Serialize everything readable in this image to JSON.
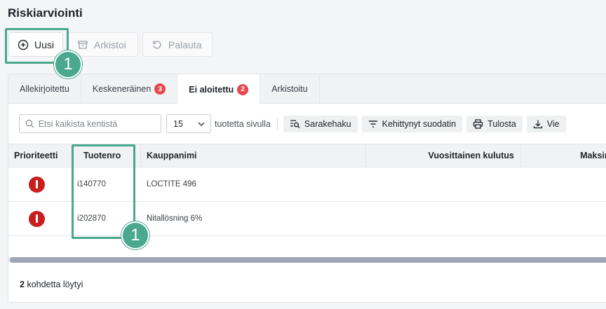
{
  "page": {
    "title": "Riskiarviointi"
  },
  "actions": {
    "new_label": "Uusi",
    "archive_label": "Arkistoi",
    "restore_label": "Palauta"
  },
  "tabs": [
    {
      "label": "Allekirjoitettu",
      "badge": null
    },
    {
      "label": "Keskeneräinen",
      "badge": "3"
    },
    {
      "label": "Ei aloitettu",
      "badge": "2",
      "active": true
    },
    {
      "label": "Arkistoitu",
      "badge": null
    }
  ],
  "toolbar": {
    "search_placeholder": "Etsi kaikista kentistä",
    "page_size": "15",
    "per_page_label": "tuotetta sivulla",
    "column_search": "Sarakehaku",
    "advanced_filter": "Kehittynyt suodatin",
    "print": "Tulosta",
    "export": "Vie"
  },
  "table": {
    "headers": [
      "Prioriteetti",
      "Tuotenro",
      "Kauppanimi",
      "Vuosittainen kulutus",
      "Maksim"
    ],
    "rows": [
      {
        "priority": "high",
        "product_no": "i140770",
        "trade_name": "LOCTITE 496",
        "annual_usage": "",
        "max": ""
      },
      {
        "priority": "high",
        "product_no": "i202870",
        "trade_name": "Nitallösning 6%",
        "annual_usage": "",
        "max": ""
      }
    ]
  },
  "footer": {
    "count": "2",
    "found_label": "kohdetta löytyi"
  },
  "annotations": {
    "marker_1": "1",
    "marker_2": "1"
  },
  "colors": {
    "accent": "#4aa88e",
    "badge": "#e5484d",
    "priority_high": "#c81e1e"
  }
}
